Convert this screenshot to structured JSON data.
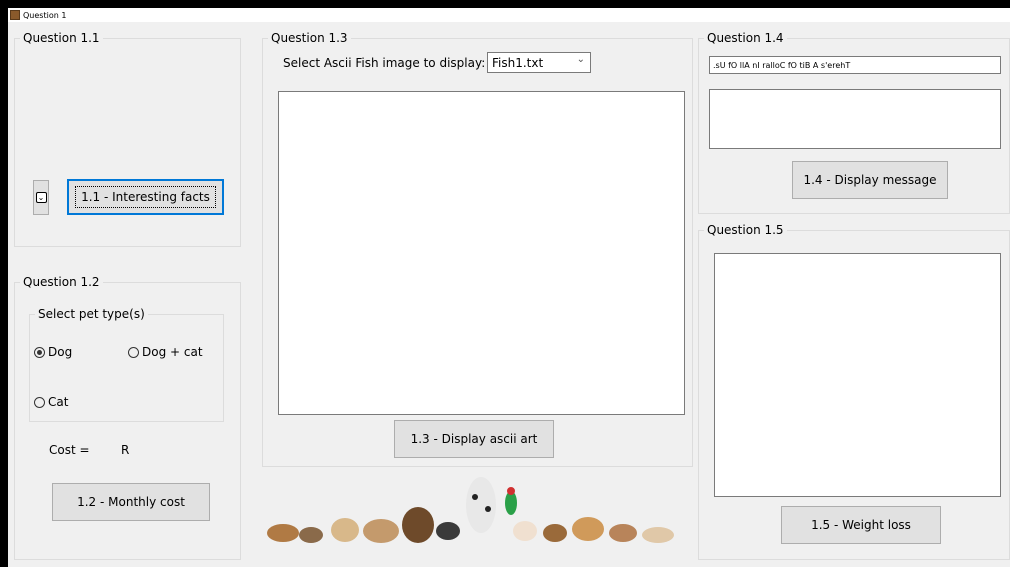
{
  "window": {
    "title": "Question 1"
  },
  "q11": {
    "legend": "Question 1.1",
    "button": "1.1 - Interesting facts"
  },
  "q12": {
    "legend": "Question 1.2",
    "pet_group_legend": "Select pet type(s)",
    "options": [
      "Dog",
      "Dog + cat",
      "Cat"
    ],
    "selected": "Dog",
    "cost_label": "Cost =",
    "cost_value": "R",
    "button": "1.2 - Monthly cost"
  },
  "q13": {
    "legend": "Question 1.3",
    "select_label": "Select Ascii Fish image to display:",
    "select_value": "Fish1.txt",
    "button": "1.3 - Display ascii art"
  },
  "q14": {
    "legend": "Question 1.4",
    "input_value": ".sU fO llA nI ralloC fO tiB A s'erehT",
    "button": "1.4 - Display message"
  },
  "q15": {
    "legend": "Question 1.5",
    "button": "1.5 - Weight loss"
  },
  "colors": {
    "focus": "#0078d7",
    "button_bg": "#e1e1e1",
    "form_bg": "#f0f0f0"
  }
}
